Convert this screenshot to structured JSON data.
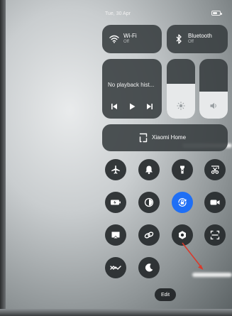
{
  "status_bar": {
    "date": "Tue, 30 Apr"
  },
  "tiles": {
    "wifi": {
      "title": "Wi-Fi",
      "state": "Off",
      "icon": "wifi-icon"
    },
    "bluetooth": {
      "title": "Bluetooth",
      "state": "Off",
      "icon": "bluetooth-icon"
    }
  },
  "media": {
    "status": "No playback hist..."
  },
  "sliders": {
    "brightness_level": 0.58,
    "volume_level": 0.45
  },
  "smart_home": {
    "label": "Xiaomi Home",
    "icon": "xiaomi-home-icon"
  },
  "toggles": [
    {
      "name": "airplane-mode",
      "icon": "airplane-icon",
      "active": false
    },
    {
      "name": "notifications",
      "icon": "bell-icon",
      "active": false
    },
    {
      "name": "flashlight",
      "icon": "flashlight-icon",
      "active": false
    },
    {
      "name": "screenshot",
      "icon": "scissors-icon",
      "active": false
    },
    {
      "name": "battery-saver",
      "icon": "battery-icon",
      "active": false
    },
    {
      "name": "reading-mode",
      "icon": "contrast-icon",
      "active": false
    },
    {
      "name": "rotation-lock",
      "icon": "lock-rotation-icon",
      "active": true
    },
    {
      "name": "screen-recorder",
      "icon": "video-camera-icon",
      "active": false
    },
    {
      "name": "cast",
      "icon": "cast-icon",
      "active": false
    },
    {
      "name": "link",
      "icon": "link-icon",
      "active": false
    },
    {
      "name": "camera",
      "icon": "camera-icon",
      "active": false
    },
    {
      "name": "scanner",
      "icon": "scan-icon",
      "active": false
    },
    {
      "name": "swipe",
      "icon": "swap-icon",
      "active": false
    },
    {
      "name": "dark-mode",
      "icon": "moon-icon",
      "active": false
    }
  ],
  "edit_button": {
    "label": "Edit"
  },
  "colors": {
    "accent": "#1f6ff5",
    "tile": "#373c3f"
  }
}
